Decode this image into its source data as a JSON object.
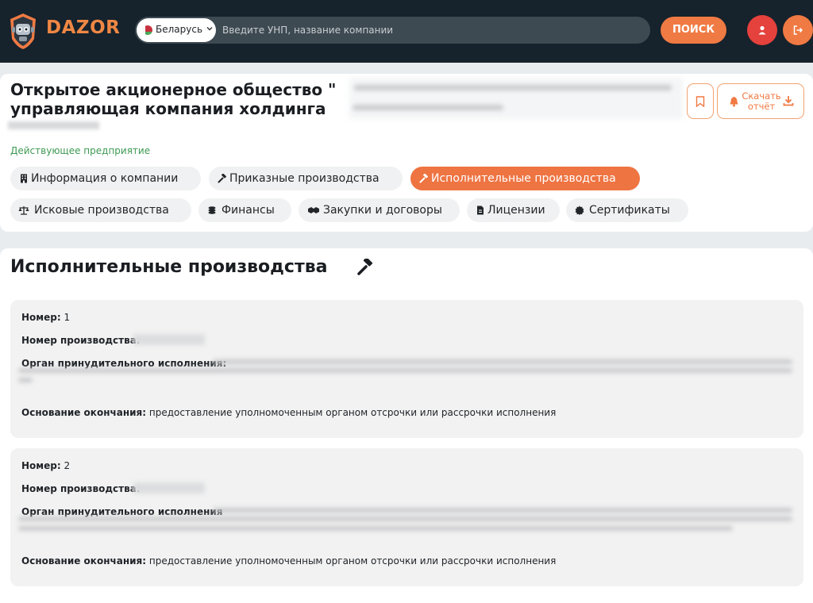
{
  "header": {
    "brand": "DAZOR",
    "country": "Беларусь",
    "search_placeholder": "Введите УНП, название компании",
    "search_button": "ПОИСК"
  },
  "company": {
    "title_line1": "Открытое акционерное общество \"",
    "title_line2": "управляющая компания холдинга",
    "status": "Действующее предприятие",
    "report_button": "Скачать отчёт",
    "tabs": [
      {
        "label": "Информация о компании",
        "icon": "building-icon",
        "active": false
      },
      {
        "label": "Приказные производства",
        "icon": "gavel-icon",
        "active": false
      },
      {
        "label": "Исполнительные производства",
        "icon": "gavel-icon",
        "active": true
      },
      {
        "label": "Исковые производства",
        "icon": "scales-icon",
        "active": false
      },
      {
        "label": "Финансы",
        "icon": "coins-icon",
        "active": false
      },
      {
        "label": "Закупки и договоры",
        "icon": "handshake-icon",
        "active": false
      },
      {
        "label": "Лицензии",
        "icon": "file-icon",
        "active": false
      },
      {
        "label": "Сертификаты",
        "icon": "certificate-icon",
        "active": false
      }
    ]
  },
  "section": {
    "title": "Исполнительные производства",
    "entries": [
      {
        "number_label": "Номер:",
        "number": "1",
        "proceeding_label": "Номер производства:",
        "organ_label": "Орган принудительного исполнения:",
        "basis_label": "Основание окончания:",
        "basis": "предоставление уполномоченным органом отсрочки или рассрочки исполнения"
      },
      {
        "number_label": "Номер:",
        "number": "2",
        "proceeding_label": "Номер производства:",
        "organ_label": "Орган принудительного исполнения",
        "basis_label": "Основание окончания:",
        "basis": "предоставление уполномоченным органом отсрочки или рассрочки исполнения"
      }
    ]
  },
  "colors": {
    "header_bg": "#16222c",
    "accent_orange": "#f07a43",
    "accent_red": "#e5413d",
    "status_green": "#3e9a54"
  }
}
